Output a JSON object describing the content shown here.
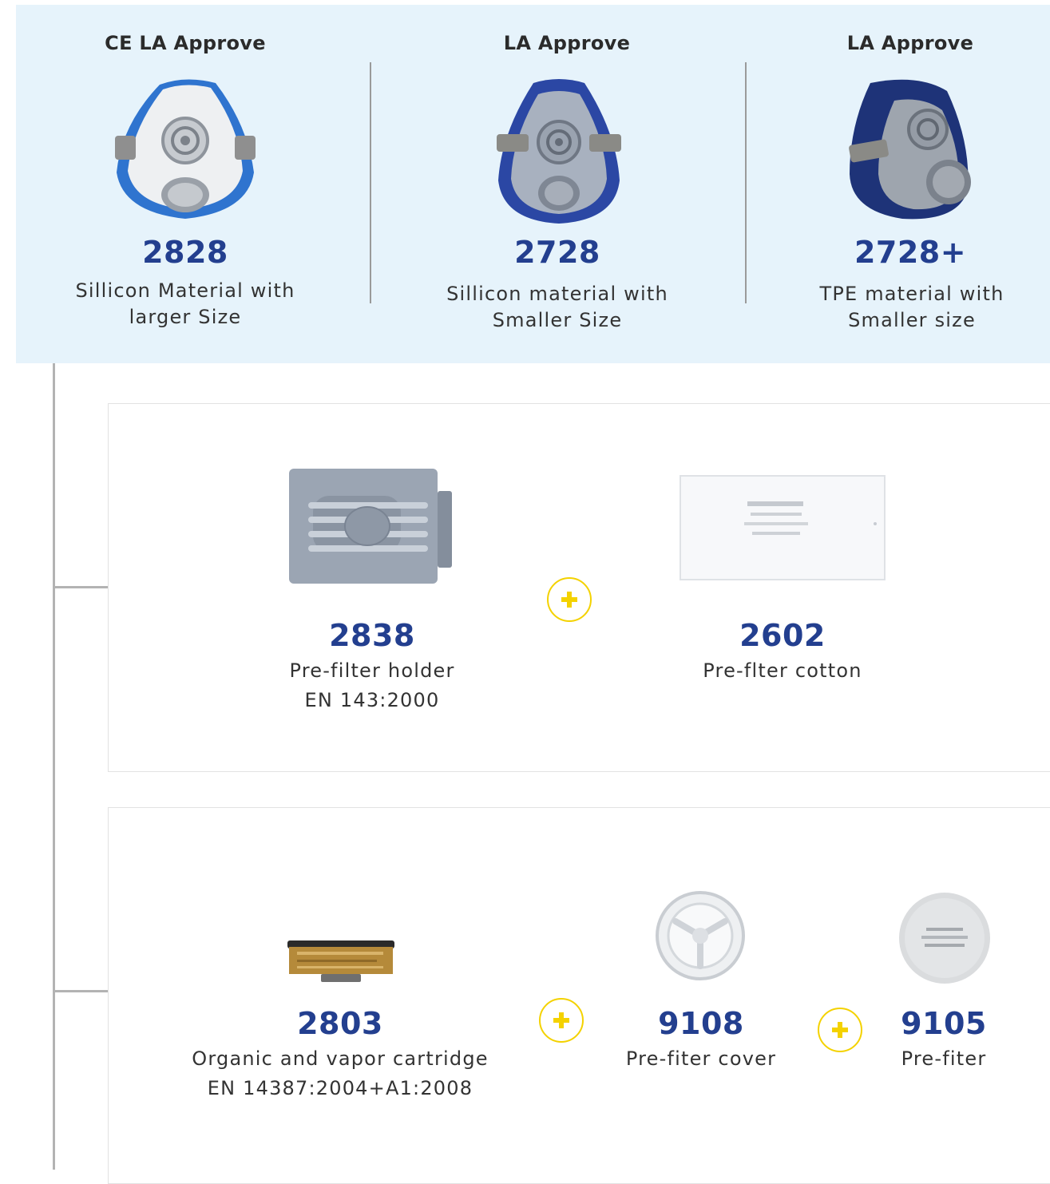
{
  "masks": [
    {
      "approval": "CE LA Approve",
      "model": "2828",
      "desc_line1": "Sillicon Material with",
      "desc_line2": "larger Size"
    },
    {
      "approval": "LA Approve",
      "model": "2728",
      "desc_line1": "Sillicon material with",
      "desc_line2": "Smaller Size"
    },
    {
      "approval": "LA Approve",
      "model": "2728+",
      "desc_line1": "TPE material with",
      "desc_line2": "Smaller size"
    }
  ],
  "prefilter_group": {
    "items": [
      {
        "model": "2838",
        "desc_line1": "Pre-filter holder",
        "desc_line2": "EN 143:2000"
      },
      {
        "model": "2602",
        "desc_line1": "Pre-flter cotton"
      }
    ]
  },
  "cartridge_group": {
    "items": [
      {
        "model": "2803",
        "desc_line1": "Organic and vapor cartridge",
        "desc_line2": "EN 14387:2004+A1:2008"
      },
      {
        "model": "9108",
        "desc_line1": "Pre-fiter cover"
      },
      {
        "model": "9105",
        "desc_line1": "Pre-fiter"
      }
    ]
  },
  "colors": {
    "panel_bg": "#e6f3fb",
    "model_blue": "#233f8f",
    "plus_yellow": "#f4d200",
    "mask_blue": "#2f5fb8",
    "mask_grey": "#a9b3c1"
  },
  "icons": {
    "mask_1": "half-mask-respirator-white-blue",
    "mask_2": "half-mask-respirator-grey-blue",
    "mask_3": "half-mask-respirator-navy",
    "filter_holder": "prefilter-holder",
    "filter_cotton": "prefilter-cotton-pad",
    "cartridge": "organic-vapor-cartridge",
    "cover": "prefilter-cover",
    "disc": "prefilter-disc",
    "plus": "plus-icon"
  }
}
